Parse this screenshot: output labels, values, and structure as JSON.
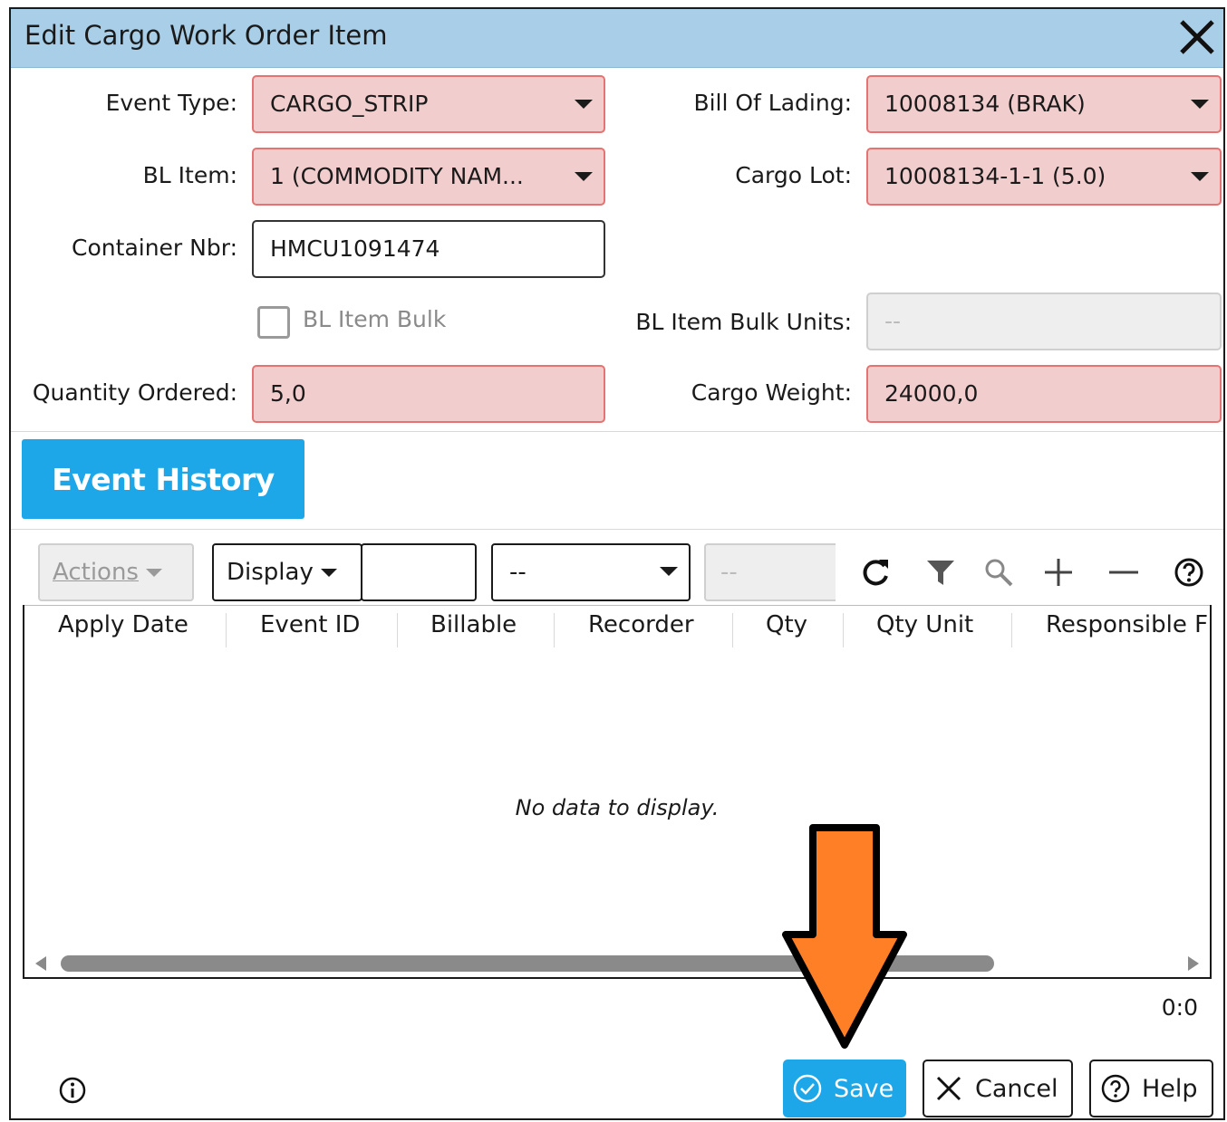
{
  "dialog": {
    "title": "Edit Cargo Work Order Item"
  },
  "form": {
    "event_type": {
      "label": "Event Type:",
      "value": "CARGO_STRIP"
    },
    "bill_of_lading": {
      "label": "Bill Of Lading:",
      "value": "10008134 (BRAK)"
    },
    "bl_item": {
      "label": "BL Item:",
      "value": "1 (COMMODITY NAM..."
    },
    "cargo_lot": {
      "label": "Cargo Lot:",
      "value": "10008134-1-1 (5.0)"
    },
    "container_nbr": {
      "label": "Container Nbr:",
      "value": "HMCU1091474"
    },
    "bl_item_bulk": {
      "label": "BL Item Bulk",
      "checked": false
    },
    "bl_item_bulk_units": {
      "label": "BL Item Bulk Units:",
      "value": "--"
    },
    "quantity_ordered": {
      "label": "Quantity Ordered:",
      "value": "5,0"
    },
    "cargo_weight": {
      "label": "Cargo Weight:",
      "value": "24000,0"
    }
  },
  "section": {
    "title": "Event History"
  },
  "toolbar": {
    "actions_label": "Actions",
    "display_label": "Display",
    "select_value": "--",
    "disabled_value": "--",
    "icons": [
      "refresh-icon",
      "filter-icon",
      "search-icon",
      "add-icon",
      "remove-icon",
      "help-icon"
    ]
  },
  "grid": {
    "columns": [
      "Apply Date",
      "Event ID",
      "Billable",
      "Recorder",
      "Qty",
      "Qty Unit",
      "Responsible F"
    ],
    "empty_message": "No data to display.",
    "counter": "0:0"
  },
  "footer": {
    "save_label": "Save",
    "cancel_label": "Cancel",
    "help_label": "Help"
  },
  "colors": {
    "titlebar": "#a9cfe8",
    "required_field": "#f1cdcd",
    "accent": "#1ea7e8",
    "annotation_arrow": "#ff7f27"
  }
}
